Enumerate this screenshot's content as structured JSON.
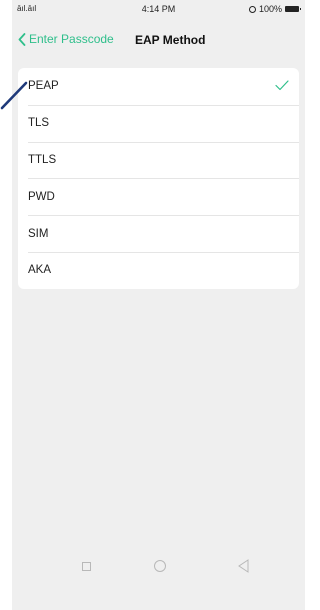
{
  "status_bar": {
    "signal": "āıl.āıl",
    "time": "4:14 PM",
    "battery": "100%"
  },
  "header": {
    "back_label": "Enter Passcode",
    "title": "EAP Method"
  },
  "options": [
    {
      "label": "PEAP",
      "selected": true
    },
    {
      "label": "TLS",
      "selected": false
    },
    {
      "label": "TTLS",
      "selected": false
    },
    {
      "label": "PWD",
      "selected": false
    },
    {
      "label": "SIM",
      "selected": false
    },
    {
      "label": "AKA",
      "selected": false
    }
  ],
  "colors": {
    "accent": "#2fbf8b",
    "background": "#efefef",
    "card": "#ffffff",
    "annotation": "#1f3a7a"
  },
  "icons": {
    "back": "chevron-left-icon",
    "check": "check-icon",
    "nav_recent": "square-icon",
    "nav_home": "circle-icon",
    "nav_back": "triangle-back-icon"
  }
}
